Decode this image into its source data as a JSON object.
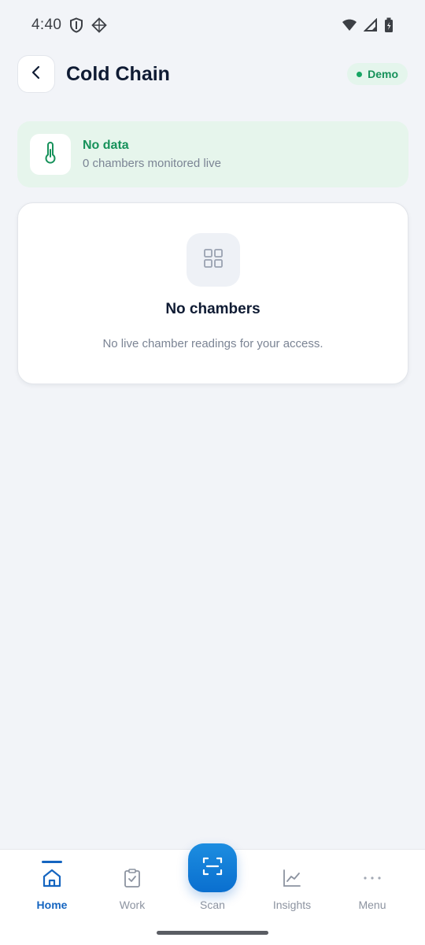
{
  "status_bar": {
    "time": "4:40"
  },
  "header": {
    "title": "Cold Chain",
    "badge": "Demo"
  },
  "summary": {
    "title": "No data",
    "subtitle": "0 chambers monitored live"
  },
  "empty_state": {
    "title": "No chambers",
    "message": "No live chamber readings for your access."
  },
  "bottom_nav": {
    "items": [
      {
        "label": "Home",
        "icon": "home-icon",
        "active": true
      },
      {
        "label": "Work",
        "icon": "clipboard-check-icon",
        "active": false
      },
      {
        "label": "Scan",
        "icon": "scan-icon",
        "active": false
      },
      {
        "label": "Insights",
        "icon": "chart-line-icon",
        "active": false
      },
      {
        "label": "Menu",
        "icon": "more-dots-icon",
        "active": false
      }
    ]
  },
  "colors": {
    "accent_blue": "#1565c0",
    "success_green": "#16915a",
    "background": "#f2f4f8"
  }
}
